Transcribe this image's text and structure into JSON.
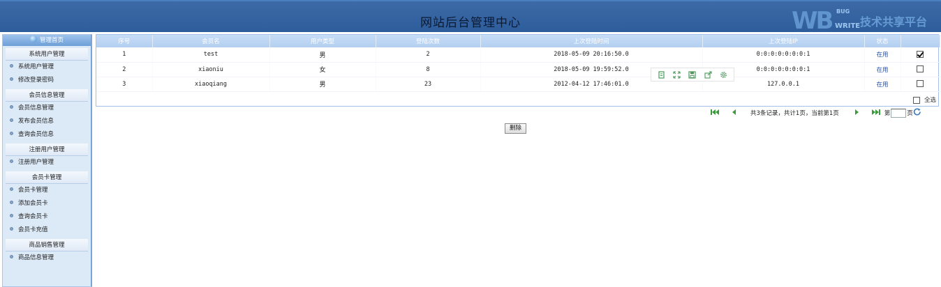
{
  "header": {
    "title": "网站后台管理中心"
  },
  "logo": {
    "mark": "WB",
    "bug": "BUG",
    "write": "WRITE",
    "slogan": "技术共享平台"
  },
  "sidebar": {
    "home_label": "管理首页",
    "groups": [
      {
        "title": "系统用户管理",
        "items": [
          "系统用户管理",
          "修改登录密码"
        ]
      },
      {
        "title": "会员信息管理",
        "items": [
          "会员信息管理",
          "发布会员信息",
          "查询会员信息"
        ]
      },
      {
        "title": "注册用户管理",
        "items": [
          "注册用户管理"
        ]
      },
      {
        "title": "会员卡管理",
        "items": [
          "会员卡管理",
          "添加会员卡",
          "查询会员卡",
          "会员卡充值"
        ]
      },
      {
        "title": "商品销售管理",
        "items": [
          "商品信息管理"
        ]
      }
    ]
  },
  "grid": {
    "columns": [
      "序号",
      "会员名",
      "用户类型",
      "登陆次数",
      "上次登陆时间",
      "上次登陆IP",
      "状态",
      ""
    ],
    "rows": [
      {
        "no": "1",
        "name": "test",
        "type": "男",
        "count": "2",
        "last_time": "2018-05-09 20:16:50.0",
        "ip": "0:0:0:0:0:0:0:1",
        "status": "在用",
        "checked": true
      },
      {
        "no": "2",
        "name": "xiaoniu",
        "type": "女",
        "count": "8",
        "last_time": "2018-05-09 19:59:52.0",
        "ip": "0:0:0:0:0:0:0:1",
        "status": "在用",
        "checked": false
      },
      {
        "no": "3",
        "name": "xiaoqiang",
        "type": "男",
        "count": "23",
        "last_time": "2012-04-12 17:46:01.0",
        "ip": "127.0.0.1",
        "status": "在用",
        "checked": false
      }
    ],
    "select_all_label": "全选"
  },
  "pager": {
    "info": "共3条记录，共计1页，当前第1页",
    "page_prefix": "第",
    "page_suffix": "页",
    "page_value": ""
  },
  "delete_button": "删除",
  "colors": {
    "header": "#2e5d9c",
    "sidebar_bg": "#dce9f7",
    "table_header": "#b3cff0",
    "status": "#1f4fa6",
    "pager_icons": "#3b9a3b"
  },
  "icons": {
    "toolbar": [
      "copy-icon",
      "fullscreen-icon",
      "save-icon",
      "share-icon",
      "settings-icon"
    ],
    "pager": [
      "first-page-icon",
      "prev-page-icon",
      "next-page-icon",
      "last-page-icon",
      "refresh-icon"
    ]
  }
}
